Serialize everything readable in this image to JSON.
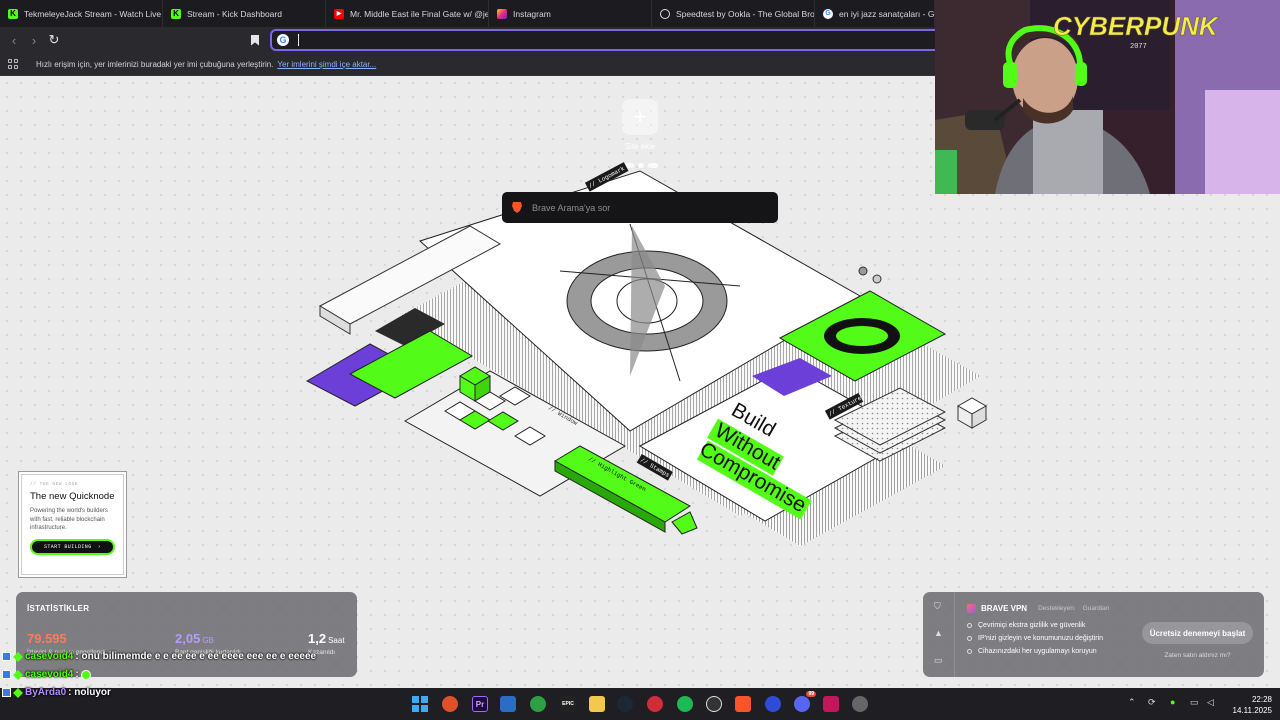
{
  "tabs": [
    {
      "title": "TekmeleyeJack Stream - Watch Live o",
      "icon": "kick-icon"
    },
    {
      "title": "Stream - Kick Dashboard",
      "icon": "kick-icon"
    },
    {
      "title": "Mr. Middle East ile Final Gate w/ @je",
      "icon": "youtube-icon"
    },
    {
      "title": "Instagram",
      "icon": "instagram-icon"
    },
    {
      "title": "Speedtest by Ookla - The Global Broa",
      "icon": "speedtest-icon"
    },
    {
      "title": "en iyi jazz sanatçaları - Goog",
      "icon": "google-icon"
    }
  ],
  "bookmarks_bar": {
    "text": "Hızlı erişim için, yer imlerinizi buradaki yer imi çubuğuna yerleştirin.",
    "link": "Yer imlerini şimdi içe aktar..."
  },
  "ntp": {
    "add_site_label": "Site ekle",
    "search_placeholder": "Brave Arama'ya sor"
  },
  "illustration_text": {
    "headline_1": "Build",
    "headline_2": "Without",
    "headline_3": "Compromise",
    "tag_logomark": "// Logomark",
    "tag_window": "// Window",
    "tag_textures": "// Textures",
    "tag_highlight": "// Highlight Green",
    "tag_stamps": "// Stamps"
  },
  "ad": {
    "tag": "// THE NEW LOOK",
    "title": "The new Quicknode",
    "description": "Powering the world's builders with fast, reliable blockchain infrastructure.",
    "button": "START BUILDING",
    "button_arrow": "›"
  },
  "stats": {
    "title": "İSTATİSTİKLER",
    "items": [
      {
        "value": "79.595",
        "unit": "",
        "caption": "İzleyici & reklam engellendi"
      },
      {
        "value": "2,05",
        "unit": "GB",
        "caption": "Bant genişliği kurtarıldı"
      },
      {
        "value": "1,2",
        "unit": "Saat",
        "caption": "Kazanıldı"
      }
    ],
    "colors": {
      "trackers": "#ff7a59",
      "bandwidth": "#b59cff",
      "time": "#ffffff"
    }
  },
  "vpn": {
    "title": "BRAVE VPN",
    "powered_by": "Destekleyen:",
    "partner": "Guardian",
    "features": [
      "Çevrimiçi ekstra gizlilik ve güvenlik",
      "IP'nizi gizleyin ve konumunuzu değiştirin",
      "Cihazınızdaki her uygulamayı koruyun"
    ],
    "cta": "Ücretsiz denemeyi başlat",
    "already_bought": "Zaten satın aldınız mı?"
  },
  "webcam": {
    "overlay_text": "CYBERPUNK",
    "overlay_sub": "2077"
  },
  "chat": [
    {
      "user": "casevoid4",
      "message": ": onu bilimemde e e ee ee e ee eeee eee ee e eeeee",
      "color": "#53fc18"
    },
    {
      "user": "casevoid4",
      "message": ": ",
      "color": "#53fc18"
    },
    {
      "user": "ByArda0",
      "message": ": noluyor",
      "color": "#b58cff"
    }
  ],
  "taskbar": {
    "apps": [
      "windows",
      "brave-orange",
      "premiere",
      "remote-desktop",
      "xbox",
      "epic",
      "file-explorer",
      "steam",
      "app-red",
      "spotify",
      "obs",
      "brave",
      "app-blue",
      "discord",
      "amd",
      "settings"
    ],
    "premiere_label": "Pr",
    "epic_label": "EPIC",
    "discord_badge": "99",
    "time": "22:28",
    "date": "14.11.2025"
  },
  "accent_colors": {
    "omnibox_border": "#7a68e6",
    "kick_green": "#53fc18",
    "purple": "#6b3fd8"
  }
}
